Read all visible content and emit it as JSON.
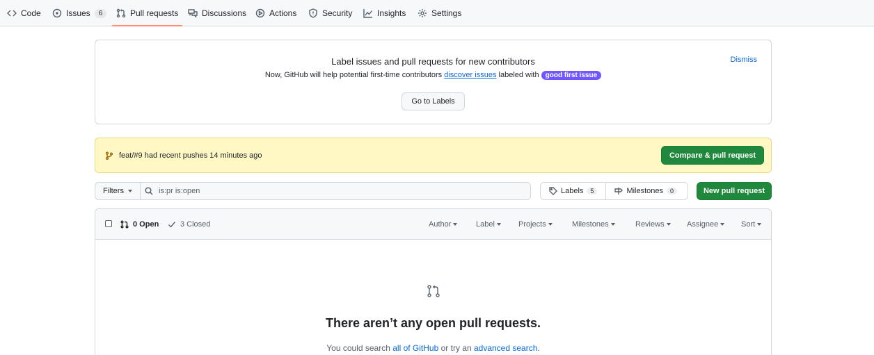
{
  "repo_nav": {
    "code": "Code",
    "issues": "Issues",
    "issues_count": "6",
    "pull_requests": "Pull requests",
    "discussions": "Discussions",
    "actions": "Actions",
    "security": "Security",
    "insights": "Insights",
    "settings": "Settings",
    "selected_underline_color": "#fd8c73"
  },
  "contributors_banner": {
    "title": "Label issues and pull requests for new contributors",
    "desc_prefix": "Now, GitHub will help potential first-time contributors",
    "desc_link": "discover issues",
    "desc_suffix": "labeled with",
    "label": "good first issue",
    "label_color": "#7057ff",
    "dismiss": "Dismiss",
    "go_to_labels": "Go to Labels"
  },
  "recent_push": {
    "branch": "feat/#9",
    "text": "had recent pushes 14 minutes ago",
    "button": "Compare & pull request"
  },
  "toolbar": {
    "filters": "Filters",
    "search_value": "is:pr is:open",
    "labels": "Labels",
    "labels_count": "5",
    "milestones": "Milestones",
    "milestones_count": "0",
    "new_pr": "New pull request"
  },
  "list_header": {
    "open": "0 Open",
    "closed": "3 Closed",
    "author": "Author",
    "label": "Label",
    "projects": "Projects",
    "milestones": "Milestones",
    "reviews": "Reviews",
    "assignee": "Assignee",
    "sort": "Sort"
  },
  "blankslate": {
    "title": "There aren’t any open pull requests.",
    "desc_prefix": "You could search",
    "link1": "all of GitHub",
    "desc_middle": "or try an",
    "link2": "advanced search",
    "desc_suffix": "."
  },
  "colors": {
    "accent_link": "#0969da",
    "primary_green": "#1f883d",
    "flash_bg": "#fff8c5"
  }
}
